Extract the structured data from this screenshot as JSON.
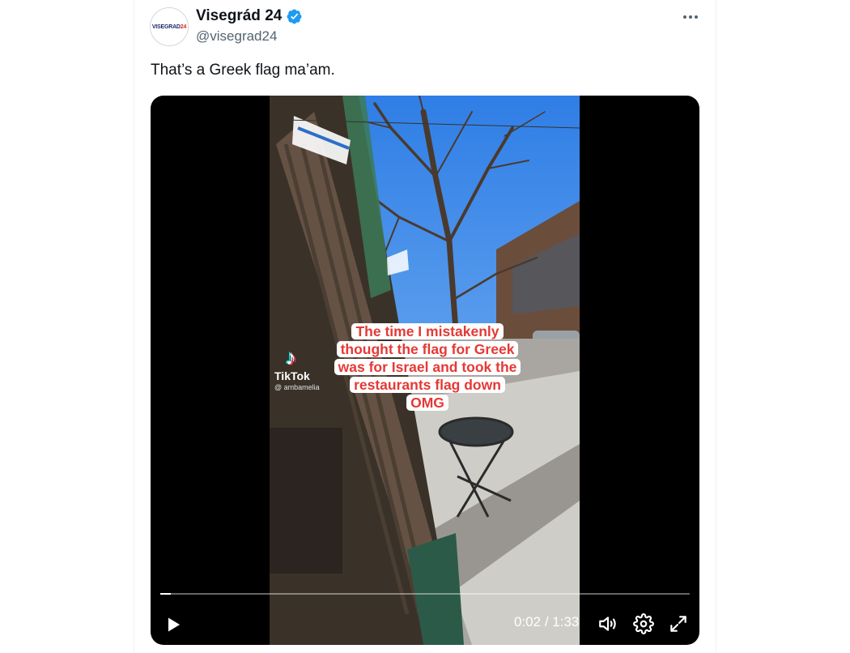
{
  "tweet": {
    "author": {
      "name": "Visegrád 24",
      "handle": "@visegrad24",
      "avatar_text_main": "VISEGRAD",
      "avatar_text_accent": "24",
      "verified": true
    },
    "text": "That’s a Greek flag ma’am."
  },
  "video": {
    "caption_lines": [
      "The time I mistakenly",
      "thought the flag for Greek",
      "was for Israel and took the",
      "restaurants flag down",
      "OMG"
    ],
    "watermark": {
      "name": "TikTok",
      "user": "@ ambamelia"
    },
    "current_time": "0:02",
    "separator": "/",
    "duration": "1:33",
    "progress": 0.02
  },
  "icons": {
    "verified": "verified-badge-icon",
    "more": "more-dots-icon",
    "play": "play-icon",
    "volume": "volume-icon",
    "settings": "gear-icon",
    "fullscreen": "fullscreen-icon"
  },
  "colors": {
    "accent": "#1d9bf0",
    "caption": "#e53935",
    "text": "#0f1419",
    "secondary": "#536471"
  }
}
